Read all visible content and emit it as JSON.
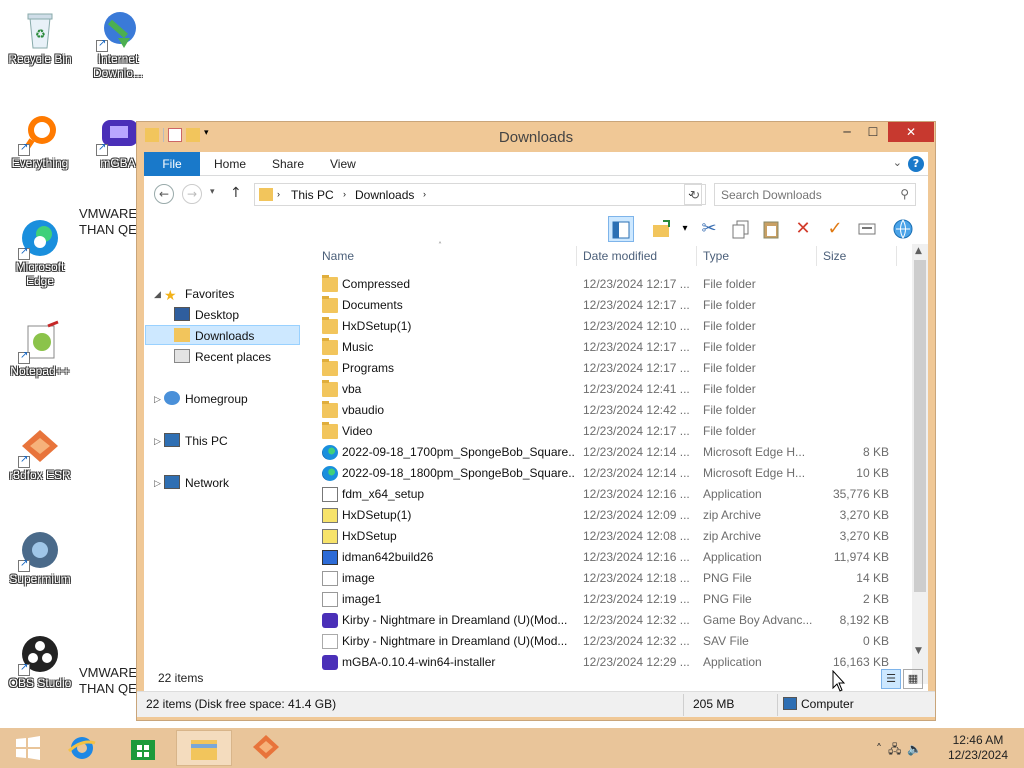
{
  "desktop": {
    "icons": [
      {
        "label": "Recycle Bin",
        "icon": "recycle-bin-icon"
      },
      {
        "label": "Internet Downlo...",
        "icon": "internet-download-manager-icon"
      },
      {
        "label": "Everything",
        "icon": "everything-search-icon"
      },
      {
        "label": "mGBA",
        "icon": "mgba-icon"
      },
      {
        "label": "Microsoft Edge",
        "icon": "edge-icon"
      },
      {
        "label": "Notepad++",
        "icon": "notepad-plus-plus-icon"
      },
      {
        "label": "r3dfox ESR",
        "icon": "r3dfox-icon"
      },
      {
        "label": "Supermium",
        "icon": "supermium-icon"
      },
      {
        "label": "OBS Studio",
        "icon": "obs-studio-icon"
      }
    ],
    "text1": "VMWARE\nTHAN QE",
    "text2": "VMWARE\nTHAN QE"
  },
  "window": {
    "title": "Downloads",
    "ribbon": {
      "file": "File",
      "home": "Home",
      "share": "Share",
      "view": "View"
    },
    "address": {
      "this_pc": "This PC",
      "downloads": "Downloads"
    },
    "search": {
      "placeholder": "Search Downloads"
    },
    "nav": {
      "favorites": "Favorites",
      "desktop": "Desktop",
      "downloads": "Downloads",
      "recent": "Recent places",
      "homegroup": "Homegroup",
      "this_pc": "This PC",
      "network": "Network"
    },
    "columns": {
      "name": "Name",
      "date": "Date modified",
      "type": "Type",
      "size": "Size"
    },
    "files": [
      {
        "name": "Compressed",
        "date": "12/23/2024 12:17 ...",
        "type": "File folder",
        "size": "",
        "icon": "folder"
      },
      {
        "name": "Documents",
        "date": "12/23/2024 12:17 ...",
        "type": "File folder",
        "size": "",
        "icon": "folder"
      },
      {
        "name": "HxDSetup(1)",
        "date": "12/23/2024 12:10 ...",
        "type": "File folder",
        "size": "",
        "icon": "folder"
      },
      {
        "name": "Music",
        "date": "12/23/2024 12:17 ...",
        "type": "File folder",
        "size": "",
        "icon": "folder"
      },
      {
        "name": "Programs",
        "date": "12/23/2024 12:17 ...",
        "type": "File folder",
        "size": "",
        "icon": "folder"
      },
      {
        "name": "vba",
        "date": "12/23/2024 12:41 ...",
        "type": "File folder",
        "size": "",
        "icon": "folder"
      },
      {
        "name": "vbaudio",
        "date": "12/23/2024 12:42 ...",
        "type": "File folder",
        "size": "",
        "icon": "folder"
      },
      {
        "name": "Video",
        "date": "12/23/2024 12:17 ...",
        "type": "File folder",
        "size": "",
        "icon": "folder"
      },
      {
        "name": "2022-09-18_1700pm_SpongeBob_Square...",
        "date": "12/23/2024 12:14 ...",
        "type": "Microsoft Edge H...",
        "size": "8 KB",
        "icon": "edge"
      },
      {
        "name": "2022-09-18_1800pm_SpongeBob_Square...",
        "date": "12/23/2024 12:14 ...",
        "type": "Microsoft Edge H...",
        "size": "10 KB",
        "icon": "edge"
      },
      {
        "name": "fdm_x64_setup",
        "date": "12/23/2024 12:16 ...",
        "type": "Application",
        "size": "35,776 KB",
        "icon": "app"
      },
      {
        "name": "HxDSetup(1)",
        "date": "12/23/2024 12:09 ...",
        "type": "zip Archive",
        "size": "3,270 KB",
        "icon": "zip"
      },
      {
        "name": "HxDSetup",
        "date": "12/23/2024 12:08 ...",
        "type": "zip Archive",
        "size": "3,270 KB",
        "icon": "zip"
      },
      {
        "name": "idman642build26",
        "date": "12/23/2024 12:16 ...",
        "type": "Application",
        "size": "11,974 KB",
        "icon": "idm"
      },
      {
        "name": "image",
        "date": "12/23/2024 12:18 ...",
        "type": "PNG File",
        "size": "14 KB",
        "icon": "png"
      },
      {
        "name": "image1",
        "date": "12/23/2024 12:19 ...",
        "type": "PNG File",
        "size": "2 KB",
        "icon": "png"
      },
      {
        "name": "Kirby - Nightmare in Dreamland (U)(Mod...",
        "date": "12/23/2024 12:32 ...",
        "type": "Game Boy Advanc...",
        "size": "8,192 KB",
        "icon": "gba"
      },
      {
        "name": "Kirby - Nightmare in Dreamland (U)(Mod...",
        "date": "12/23/2024 12:32 ...",
        "type": "SAV File",
        "size": "0 KB",
        "icon": "sav"
      },
      {
        "name": "mGBA-0.10.4-win64-installer",
        "date": "12/23/2024 12:29 ...",
        "type": "Application",
        "size": "16,163 KB",
        "icon": "gba"
      }
    ],
    "item_count": "22 items",
    "status": {
      "disk": "22 items (Disk free space: 41.4 GB)",
      "size": "205 MB",
      "location": "Computer"
    }
  },
  "taskbar": {
    "time": "12:46 AM",
    "date": "12/23/2024"
  }
}
